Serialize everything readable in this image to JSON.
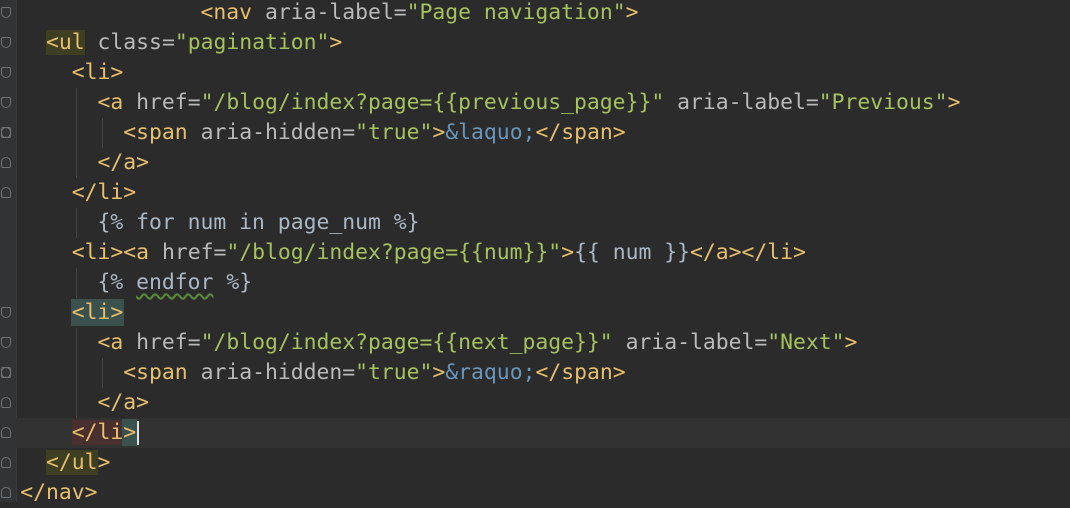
{
  "editor": {
    "lines": [
      "<nav aria-label=\"Page navigation\">",
      "<ul class=\"pagination\">",
      "<li>",
      "<a href=\"/blog/index?page={{previous_page}}\" aria-label=\"Previous\">",
      "<span aria-hidden=\"true\">&laquo;</span>",
      "</a>",
      "</li>",
      "{% for num in page_num %}",
      "<li><a href=\"/blog/index?page={{num}}\">{{ num }}</a></li>",
      "{% endfor %}",
      "<li>",
      "<a href=\"/blog/index?page={{next_page}}\" aria-label=\"Next\">",
      "<span aria-hidden=\"true\">&raquo;</span>",
      "</a>",
      "</li>",
      "</ul>",
      "</nav>"
    ],
    "colors": {
      "background": "#2b2b2b",
      "gutter": "#313335",
      "tag": "#e8bf6a",
      "attribute": "#bababa",
      "string": "#a5c25c",
      "entity": "#6897bb",
      "text": "#a9b7c6",
      "current_line": "#323232"
    },
    "icons": [
      "fold-open-icon",
      "fold-close-icon",
      "text-caret"
    ]
  }
}
